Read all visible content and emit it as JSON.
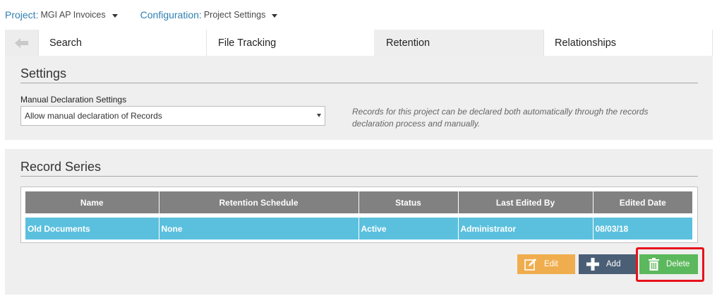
{
  "topbar": {
    "project_label": "Project:",
    "project_value": "MGI AP Invoices",
    "config_label": "Configuration:",
    "config_value": "Project Settings"
  },
  "tabs": [
    {
      "label": "Search"
    },
    {
      "label": "File Tracking"
    },
    {
      "label": "Retention",
      "active": true
    },
    {
      "label": "Relationships"
    }
  ],
  "settings": {
    "title": "Settings",
    "field_label": "Manual Declaration Settings",
    "select_value": "Allow manual declaration of Records",
    "note": "Records for this project can be declared both automatically through the records declaration process and manually."
  },
  "records": {
    "title": "Record Series",
    "columns": [
      "Name",
      "Retention Schedule",
      "Status",
      "Last Edited By",
      "Edited Date"
    ],
    "rows": [
      [
        "Old Documents",
        "None",
        "Active",
        "Administrator",
        "08/03/18"
      ]
    ]
  },
  "buttons": {
    "edit": "Edit",
    "add": "Add",
    "delete": "Delete"
  },
  "colors": {
    "accent": "#2f7fb0",
    "row_selected": "#5bc0de",
    "header": "#818181",
    "edit": "#f0ad4e",
    "add": "#4a5f76",
    "delete": "#5cb85c",
    "highlight": "#e8111b"
  },
  "icons": {
    "back": "arrow-left-icon",
    "edit": "pencil-square-icon",
    "add": "plus-icon",
    "delete": "trash-icon"
  }
}
